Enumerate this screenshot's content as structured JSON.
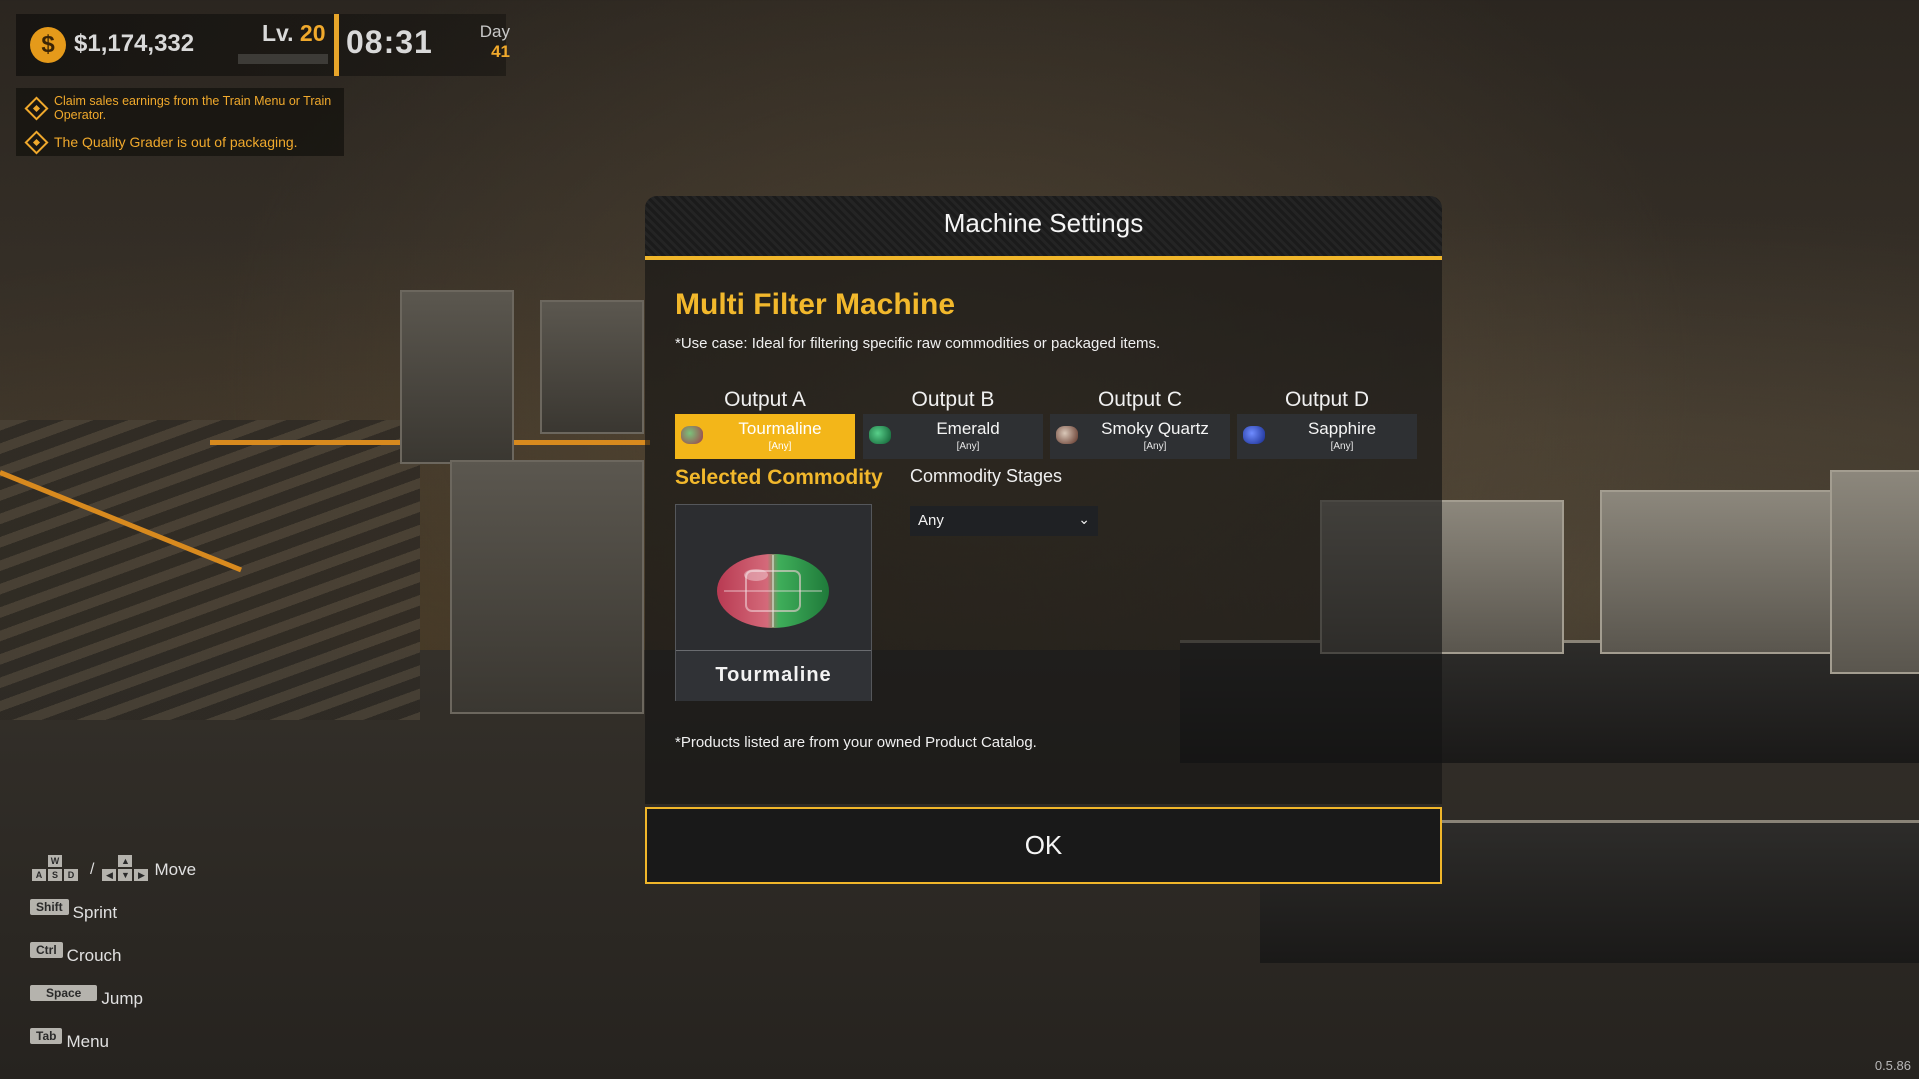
{
  "hud": {
    "money": "$1,174,332",
    "coin_symbol": "$",
    "level_prefix": "Lv.",
    "level": "20",
    "clock": "08:31",
    "day_label": "Day",
    "day_number": "41"
  },
  "notifications": [
    "Claim sales earnings from the Train Menu or Train Operator.",
    "The Quality Grader is out of packaging."
  ],
  "controls": {
    "move_keys": [
      "W",
      "A",
      "S",
      "D"
    ],
    "move_label": "Move",
    "sprint_key": "Shift",
    "sprint_label": "Sprint",
    "crouch_key": "Ctrl",
    "crouch_label": "Crouch",
    "jump_key": "Space",
    "jump_label": "Jump",
    "menu_key": "Tab",
    "menu_label": "Menu"
  },
  "version": "0.5.86",
  "dialog": {
    "title": "Machine Settings",
    "machine_name": "Multi Filter Machine",
    "use_case": "*Use case: Ideal for filtering specific raw commodities or packaged items.",
    "outputs": [
      {
        "header": "Output A",
        "commodity": "Tourmaline",
        "stage": "[Any]",
        "selected": true,
        "icon": "tourmaline-gem-icon",
        "color": "#5aa35a"
      },
      {
        "header": "Output B",
        "commodity": "Emerald",
        "stage": "[Any]",
        "selected": false,
        "icon": "emerald-gem-icon",
        "color": "#1f9b5a"
      },
      {
        "header": "Output C",
        "commodity": "Smoky Quartz",
        "stage": "[Any]",
        "selected": false,
        "icon": "smoky-quartz-gem-icon",
        "color": "#7a4a3a"
      },
      {
        "header": "Output D",
        "commodity": "Sapphire",
        "stage": "[Any]",
        "selected": false,
        "icon": "sapphire-gem-icon",
        "color": "#2a4fd0"
      }
    ],
    "selected_commodity_label": "Selected Commodity",
    "commodity_stages_label": "Commodity Stages",
    "stage_value": "Any",
    "selected_commodity_name": "Tourmaline",
    "footnote": "*Products listed are from your owned Product Catalog.",
    "ok_label": "OK"
  },
  "colors": {
    "accent": "#f2b82c",
    "coin": "#e59a1a"
  }
}
